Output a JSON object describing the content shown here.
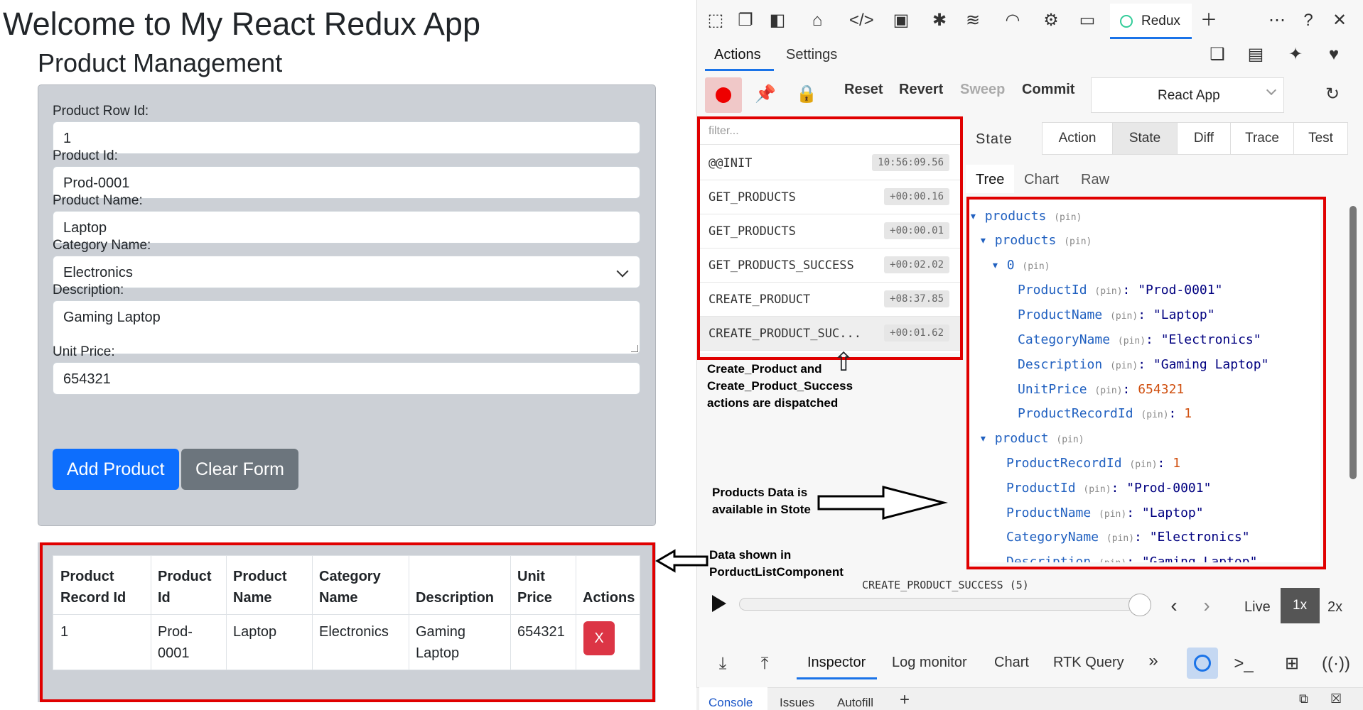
{
  "app": {
    "title": "Welcome to My React Redux App",
    "subtitle": "Product Management"
  },
  "form": {
    "row_id_label": "Product Row Id:",
    "row_id_value": "1",
    "product_id_label": "Product Id:",
    "product_id_value": "Prod-0001",
    "name_label": "Product Name:",
    "name_value": "Laptop",
    "category_label": "Category Name:",
    "category_value": "Electronics",
    "description_label": "Description:",
    "description_value": "Gaming Laptop",
    "price_label": "Unit Price:",
    "price_value": "654321",
    "add_button": "Add Product",
    "clear_button": "Clear Form"
  },
  "table": {
    "headers": [
      [
        "Product",
        "Record Id"
      ],
      [
        "Product",
        "Id"
      ],
      [
        "Product",
        "Name"
      ],
      [
        "Category",
        "Name"
      ],
      [
        "Description",
        ""
      ],
      [
        "Unit",
        "Price"
      ],
      [
        "Actions",
        ""
      ]
    ],
    "row": {
      "record_id": "1",
      "product_id_1": "Prod-",
      "product_id_2": "0001",
      "name": "Laptop",
      "category": "Electronics",
      "desc_1": "Gaming",
      "desc_2": "Laptop",
      "price": "654321",
      "delete": "X"
    }
  },
  "annotations": {
    "actions_note_1": "Create_Product and",
    "actions_note_2": "Create_Product_Success",
    "actions_note_3": "actions are dispatched",
    "store_note_1": "Products Data is",
    "store_note_2": "available in Stote",
    "list_note_1": "Data shown in",
    "list_note_2": "PorductListComponent"
  },
  "devtools": {
    "active_tab": "Redux",
    "subtabs": [
      "Actions",
      "Settings"
    ],
    "toolbar": {
      "reset": "Reset",
      "revert": "Revert",
      "sweep": "Sweep",
      "commit": "Commit",
      "instance": "React App"
    },
    "filter_placeholder": "filter...",
    "actions": [
      {
        "name": "@@INIT",
        "time": "10:56:09.56"
      },
      {
        "name": "GET_PRODUCTS",
        "time": "+00:00.16"
      },
      {
        "name": "GET_PRODUCTS",
        "time": "+00:00.01"
      },
      {
        "name": "GET_PRODUCTS_SUCCESS",
        "time": "+00:02.02"
      },
      {
        "name": "CREATE_PRODUCT",
        "time": "+08:37.85"
      },
      {
        "name": "CREATE_PRODUCT_SUC...",
        "time": "+00:01.62"
      }
    ],
    "state_label": "State",
    "monitor_tabs": [
      "Action",
      "State",
      "Diff",
      "Trace",
      "Test"
    ],
    "view_tabs": [
      "Tree",
      "Chart",
      "Raw"
    ],
    "pin": "(pin)",
    "tree": {
      "products": "products",
      "products_inner": "products",
      "index0": "0",
      "ProductId": "ProductId",
      "ProductId_v": "\"Prod-0001\"",
      "ProductName": "ProductName",
      "ProductName_v": "\"Laptop\"",
      "CategoryName": "CategoryName",
      "CategoryName_v": "\"Electronics\"",
      "Description": "Description",
      "Description_v": "\"Gaming Laptop\"",
      "UnitPrice": "UnitPrice",
      "UnitPrice_v": "654321",
      "ProductRecordId": "ProductRecordId",
      "ProductRecordId_v": "1",
      "product": "product",
      "p_ProductRecordId_v": "1",
      "p_ProductId_v": "\"Prod-0001\"",
      "p_ProductName_v": "\"Laptop\"",
      "p_CategoryName_v": "\"Electronics\"",
      "p_Description_v": "\"Gaming Laptop\""
    },
    "slider_label": "CREATE_PRODUCT_SUCCESS (5)",
    "live": "Live",
    "speed1": "1x",
    "speed2": "2x",
    "bottom_tabs": [
      "Inspector",
      "Log monitor",
      "Chart",
      "RTK Query"
    ],
    "drawer_tabs": [
      "Console",
      "Issues",
      "Autofill"
    ]
  }
}
